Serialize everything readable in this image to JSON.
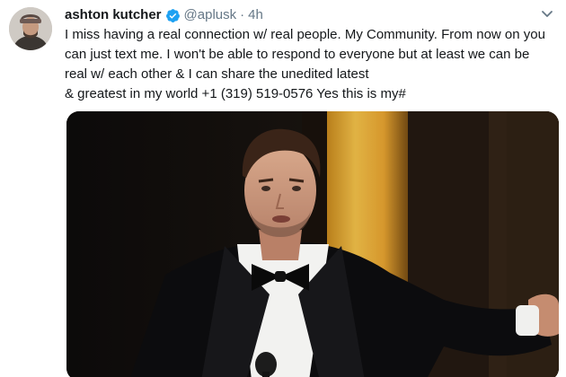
{
  "tweet": {
    "display_name": "ashton kutcher",
    "handle": "@aplusk",
    "separator": "·",
    "timestamp": "4h",
    "text_lines": [
      "I miss having a real connection w/ real people. My Community. From now on you",
      "can just text me. I won't be able to respond to everyone but at least we can be",
      "real w/ each other & I can share the unedited latest",
      "& greatest in my world +1 (319) 519-0576 Yes this is my#"
    ],
    "verified": true
  },
  "icons": {
    "avatar": "profile-avatar",
    "verified": "verified-badge-icon",
    "menu": "chevron-down-icon"
  },
  "colors": {
    "verified_blue": "#1da1f2",
    "secondary_text": "#657786",
    "primary_text": "#14171a"
  }
}
